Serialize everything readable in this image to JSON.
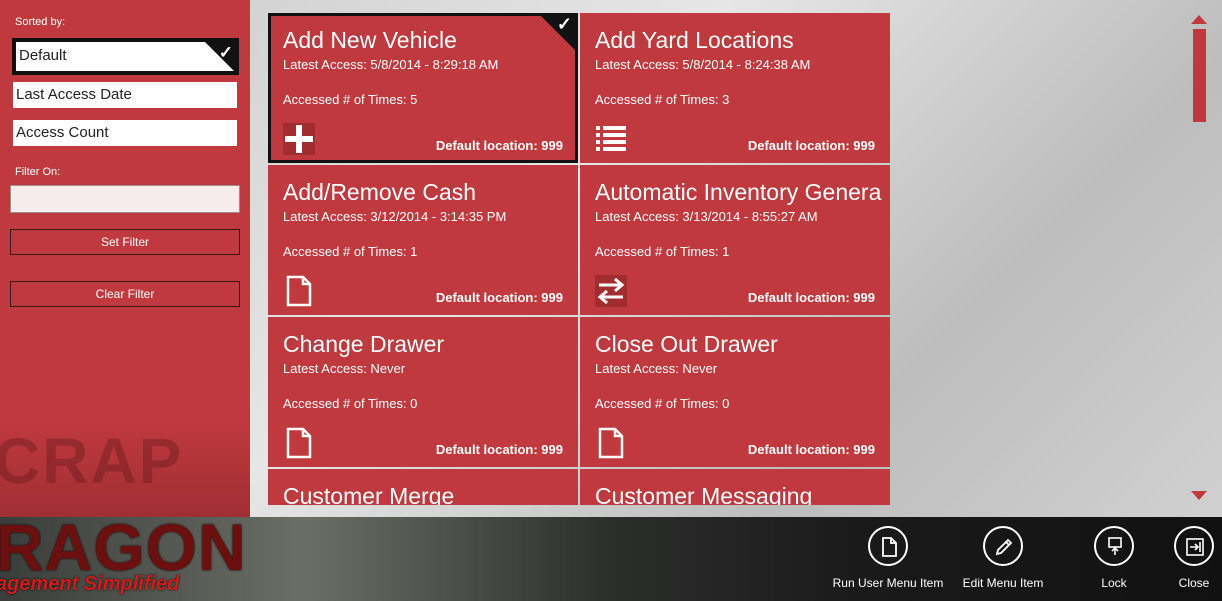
{
  "sidebar": {
    "sorted_by_label": "Sorted by:",
    "sort_options": [
      "Default",
      "Last Access Date",
      "Access Count"
    ],
    "filter_label": "Filter On:",
    "filter_value": "",
    "set_filter_label": "Set Filter",
    "clear_filter_label": "Clear Filter",
    "background_word": "CRAP"
  },
  "tiles": [
    {
      "title": "Add New Vehicle",
      "access": "Latest Access: 5/8/2014 - 8:29:18 AM",
      "count": "Accessed # of Times: 5",
      "location": "Default location: 999",
      "icon": "plus-icon"
    },
    {
      "title": "Add Yard Locations",
      "access": "Latest Access: 5/8/2014 - 8:24:38 AM",
      "count": "Accessed # of Times: 3",
      "location": "Default location: 999",
      "icon": "list-icon"
    },
    {
      "title": "Add/Remove Cash",
      "access": "Latest Access: 3/12/2014 - 3:14:35 PM",
      "count": "Accessed # of Times: 1",
      "location": "Default location: 999",
      "icon": "document-icon"
    },
    {
      "title": "Automatic Inventory Genera",
      "access": "Latest Access: 3/13/2014 - 8:55:27 AM",
      "count": "Accessed # of Times: 1",
      "location": "Default location: 999",
      "icon": "swap-arrows-icon"
    },
    {
      "title": "Change Drawer",
      "access": "Latest Access: Never",
      "count": "Accessed # of Times: 0",
      "location": "Default location: 999",
      "icon": "document-icon"
    },
    {
      "title": "Close Out Drawer",
      "access": "Latest Access: Never",
      "count": "Accessed # of Times: 0",
      "location": "Default location: 999",
      "icon": "document-icon"
    },
    {
      "title": "Customer Merge",
      "access": "",
      "count": "",
      "location": "",
      "icon": ""
    },
    {
      "title": "Customer Messaging",
      "access": "",
      "count": "",
      "location": "",
      "icon": ""
    }
  ],
  "appbar": {
    "logo_word": "RAGON",
    "logo_tagline": "agement Simplified",
    "run_label": "Run User Menu Item",
    "edit_label": "Edit Menu Item",
    "lock_label": "Lock",
    "close_label": "Close"
  },
  "colors": {
    "accent": "#c0393e",
    "selected_border": "#111111"
  }
}
